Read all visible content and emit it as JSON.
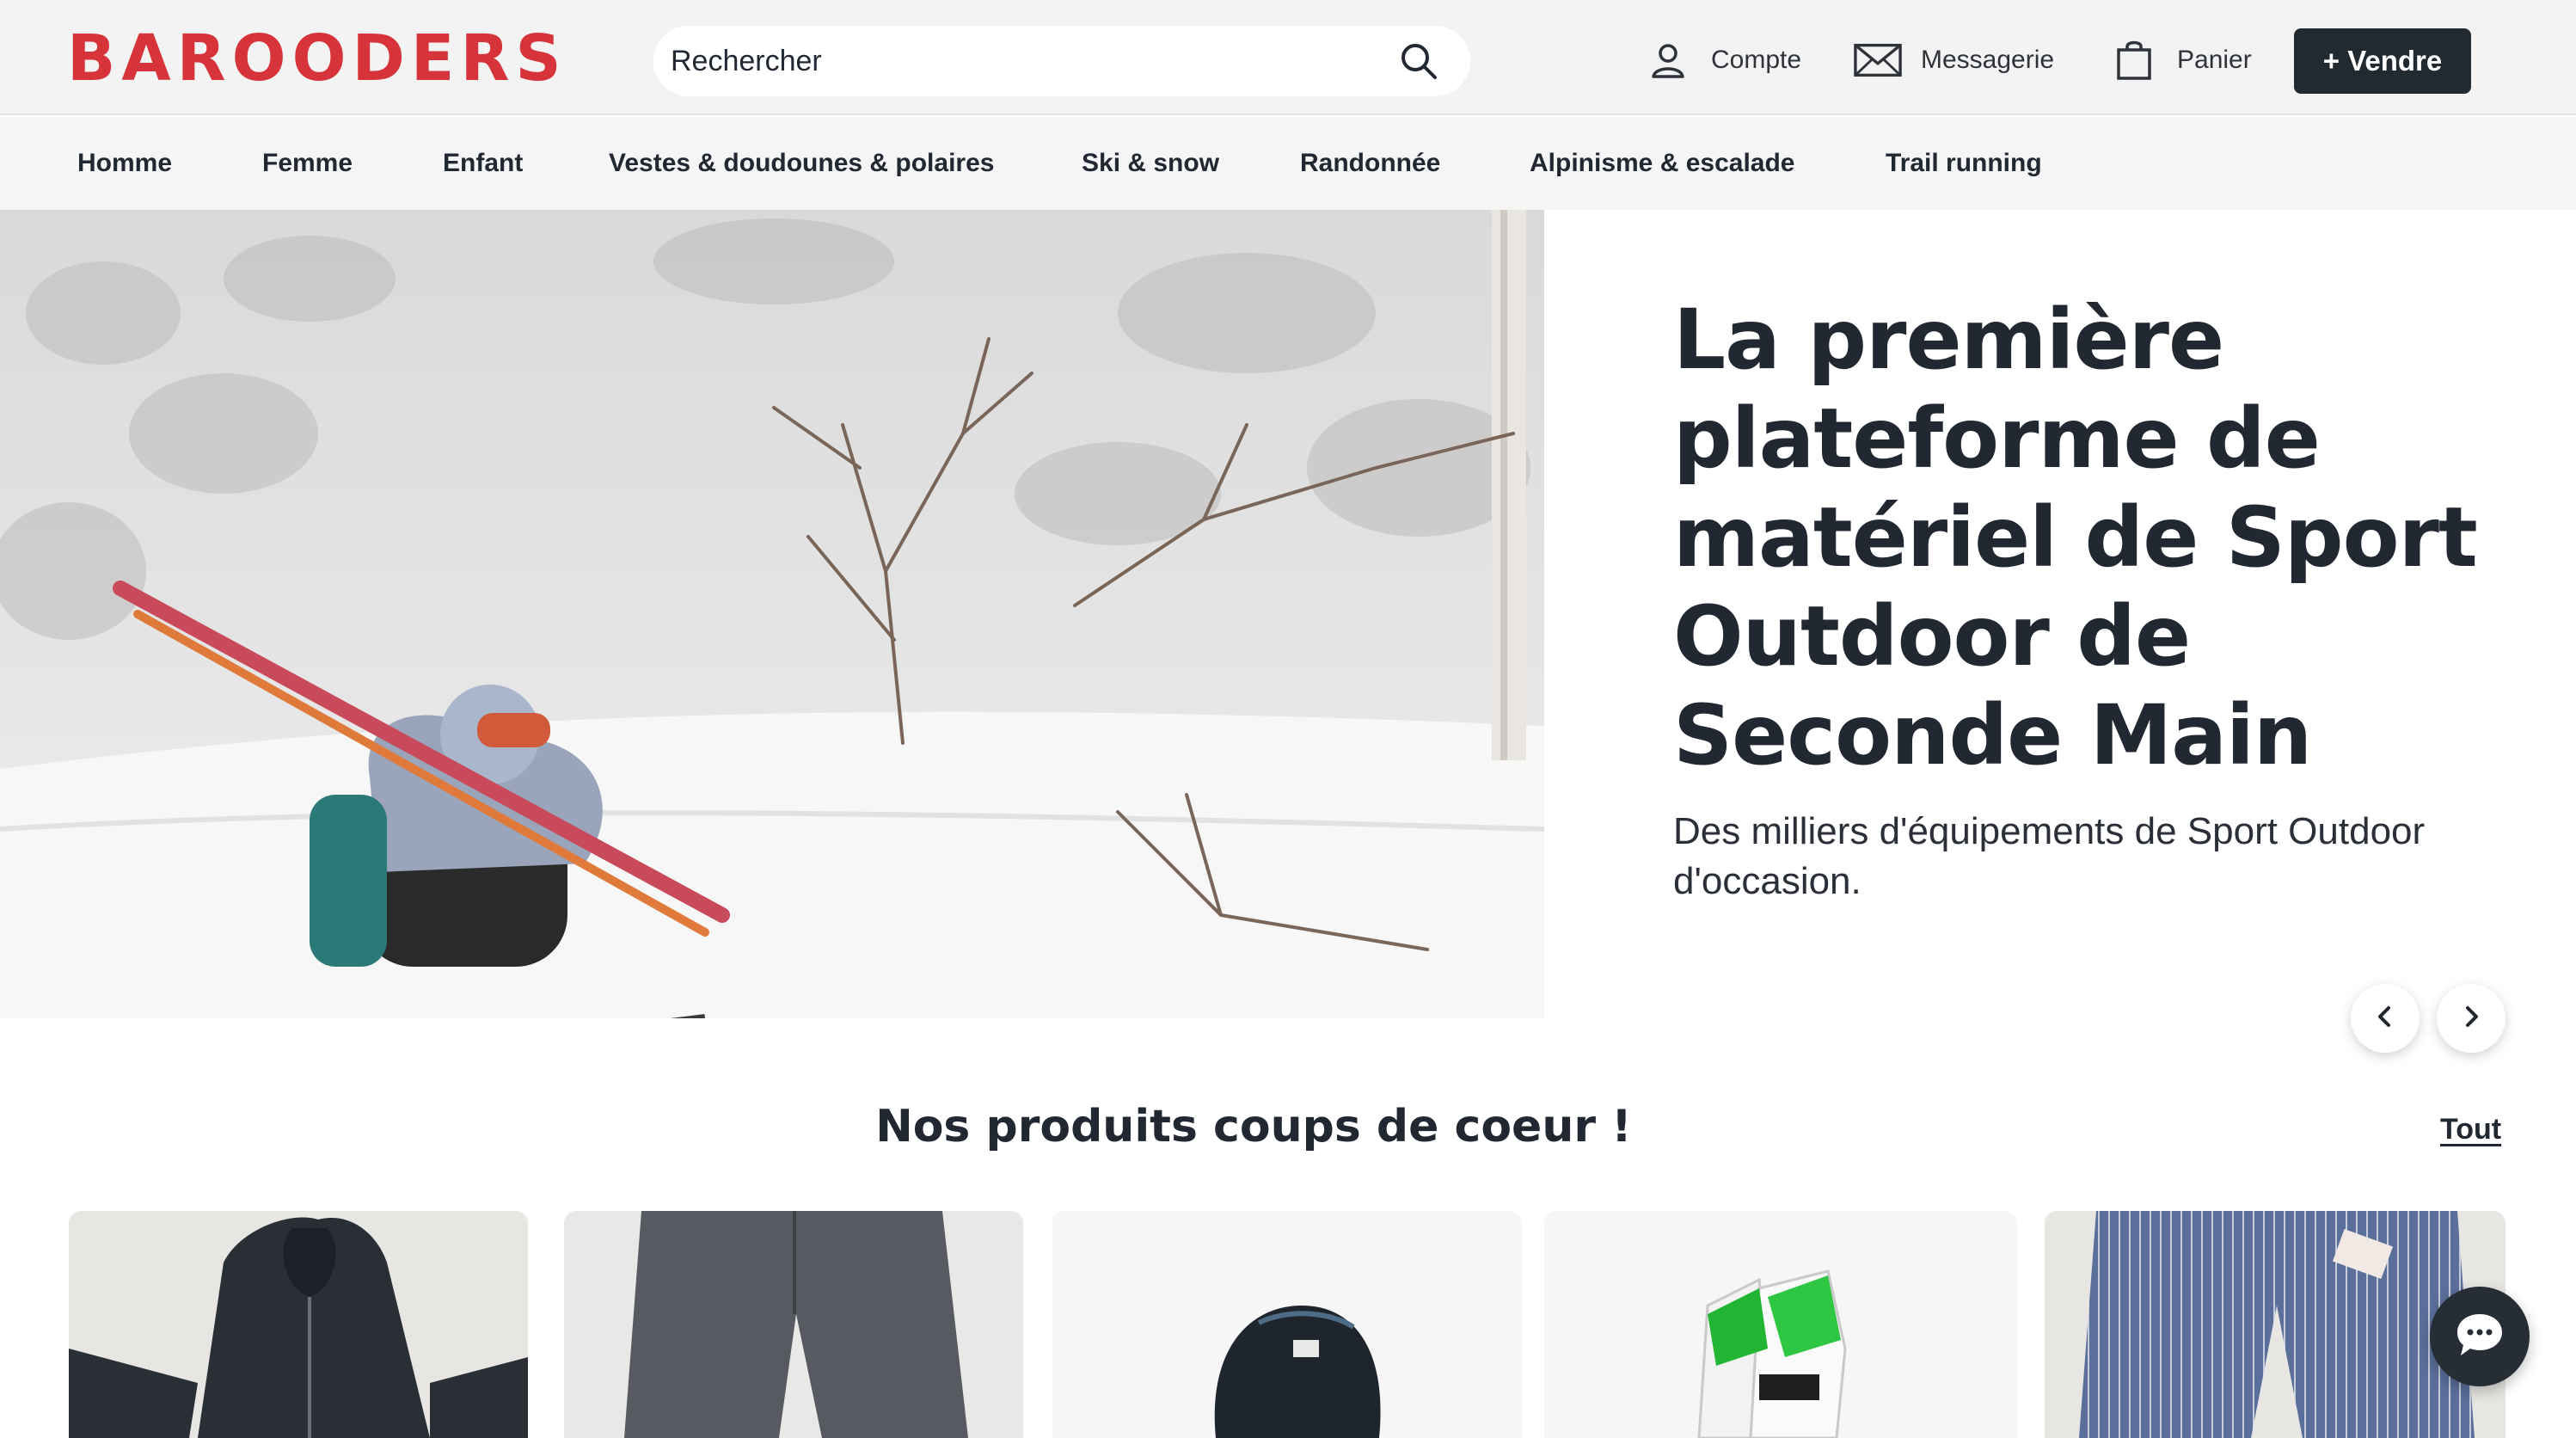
{
  "header": {
    "logo_text": "BAROODERS",
    "search_placeholder": "Rechercher",
    "account_label": "Compte",
    "messages_label": "Messagerie",
    "cart_label": "Panier",
    "sell_label": "+ Vendre"
  },
  "categories": [
    {
      "label": "Homme"
    },
    {
      "label": "Femme"
    },
    {
      "label": "Enfant"
    },
    {
      "label": "Vestes & doudounes & polaires"
    },
    {
      "label": "Ski & snow"
    },
    {
      "label": "Randonnée"
    },
    {
      "label": "Alpinisme & escalade"
    },
    {
      "label": "Trail running"
    }
  ],
  "hero": {
    "title": "La première plateforme de matériel de Sport Outdoor de Seconde Main",
    "subtitle": "Des milliers d'équipements de Sport Outdoor d'occasion."
  },
  "products_section": {
    "title": "Nos produits coups de coeur !",
    "see_all_label": "Tout",
    "products": [
      {
        "image": "black-ski-jacket"
      },
      {
        "image": "grey-ski-pants"
      },
      {
        "image": "black-helmet-backpack"
      },
      {
        "image": "green-white-ski-boots"
      },
      {
        "image": "blue-striped-ski-pants"
      }
    ]
  },
  "colors": {
    "brand_red": "#d7333a",
    "dark": "#222a31",
    "header_bg": "#f3f3f3"
  },
  "icons": [
    "search-icon",
    "user-icon",
    "mail-icon",
    "shopping-bag-icon",
    "chevron-left-icon",
    "chevron-right-icon",
    "chat-icon"
  ]
}
